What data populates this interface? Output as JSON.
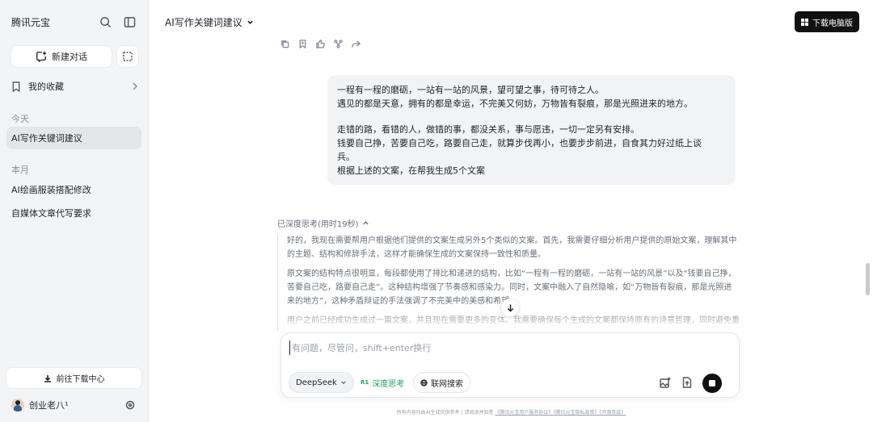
{
  "sidebar": {
    "app_name": "腾讯元宝",
    "new_chat_label": "新建对话",
    "favorites_label": "我的收藏",
    "groups": [
      {
        "label": "今天",
        "items": [
          "AI写作关键词建议"
        ]
      },
      {
        "label": "本月",
        "items": [
          "AI绘画服装搭配修改",
          "自媒体文章代写要求"
        ]
      }
    ],
    "download_center_label": "前往下载中心",
    "user_name": "创业老八¹"
  },
  "header": {
    "chat_title": "AI写作关键词建议",
    "download_pc_label": "下载电脑版"
  },
  "user_message": {
    "lines": [
      "一程有一程的磨砺，一站有一站的风景，望可望之事，待可待之人。",
      "遇见的都是天意，拥有的都是幸运，不完美又何妨，万物皆有裂痕，那是光照进来的地方。",
      "",
      "走错的路，看错的人，做错的事，都没关系，事与愿违，一切一定另有安排。",
      "钱要自己挣，苦要自己吃，路要自己走，就算步伐再小，也要步步前进，自食其力好过纸上谈",
      "兵。",
      "根据上述的文案，在帮我生成5个文案"
    ]
  },
  "thinking": {
    "header": "已深度思考(用时19秒)",
    "paragraphs": [
      "好的，我现在需要帮用户根据他们提供的文案生成另外5个类似的文案。首先，我需要仔细分析用户提供的原始文案，理解其中的主题、结构和修辞手法，这样才能确保生成的文案保持一致性和质量。",
      "原文案的结构特点很明显，每段都使用了排比和递进的结构，比如“一程有一程的磨砺，一站有一站的风景”以及“钱要自己挣，苦要自己吃，路要自己走”。这种结构增强了节奏感和感染力。同时，文案中融入了自然隐喻，如“万物皆有裂痕，那是光照进来的地方”，这种矛盾辩证的手法强调了不完美中的美感和希望。",
      "用户之前已经成功生成过一篇文案，并且现在需要更多的变体。我需要确保每个生成的文案都保持原有的诗意哲理，同时避免重"
    ]
  },
  "composer": {
    "placeholder": "有问题，尽管问，shift+enter换行",
    "model": "DeepSeek",
    "deep_think_badge": "R1",
    "deep_think_label": "深度思考",
    "web_search_label": "联网搜索"
  },
  "footer": {
    "text": "所有内容均由AI生成仅供参考 | 请阅读并知悉",
    "links": [
      "《腾讯元宝用户服务协议》",
      "《腾讯元宝隐私政策》",
      "《开源条款》"
    ]
  },
  "colors": {
    "accent_green": "#1fa35f",
    "dark_button": "#111111",
    "sidebar_bg": "#f3f4f5"
  }
}
